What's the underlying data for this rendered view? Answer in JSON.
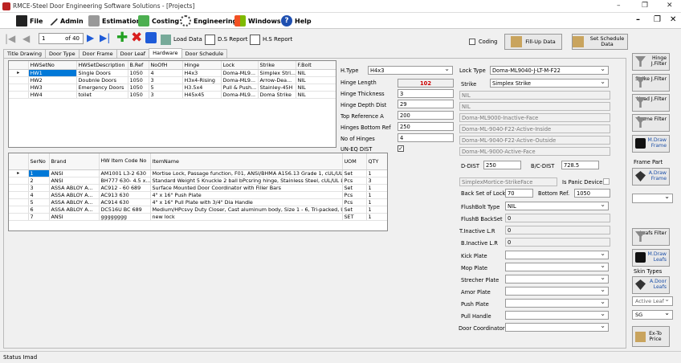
{
  "window": {
    "title": "RMCE-Steel Door Engineering Software Solutions - [Projects]"
  },
  "menu": [
    "File",
    "Admin",
    "Estimation",
    "Costing",
    "Engineering",
    "Windows",
    "Help"
  ],
  "toolbar": {
    "record": "1",
    "of": "of 40",
    "load_data": "Load Data",
    "ds_report": "D.S Report",
    "hs_report": "H.S Report",
    "coding": "Coding",
    "fill_up": "Fill-Up Data",
    "set_schedule": "Set Schedule Data"
  },
  "tabs": [
    "Title Drawing",
    "Door Type",
    "Door Frame",
    "Door Leaf",
    "Hardware",
    "Door Schedule"
  ],
  "hw_grid": {
    "headers": [
      "HWSetNo",
      "HWSetDescription",
      "B.Ref",
      "NoOfH",
      "Hinge",
      "Lock",
      "Strike",
      "F.Bolt"
    ],
    "rows": [
      [
        "HW1",
        "Single Doors",
        "1050",
        "4",
        "H4x3",
        "Doma-ML9...",
        "Simplex Stri...",
        "NIL"
      ],
      [
        "HW2",
        "Doubnle Doors",
        "1050",
        "3",
        "H3x4-Rising",
        "Doma-ML9...",
        "Arrow-Dea...",
        "NIL"
      ],
      [
        "HW3",
        "Emergency Doors",
        "1050",
        "5",
        "H3.5x4",
        "Pull & Push...",
        "Stainley-45H",
        "NIL"
      ],
      [
        "HW4",
        "toilet",
        "1050",
        "3",
        "H45x45",
        "Doma-ML9...",
        "Doma Strike",
        "NIL"
      ]
    ]
  },
  "items_grid": {
    "headers": [
      "SerNo",
      "Brand",
      "HW Item Code No",
      "ItemName",
      "UOM",
      "QTY"
    ],
    "rows": [
      [
        "1",
        "ANSI",
        "AM1001 L3-2 630",
        "Mortise Lock, Passage function, F01, ANSI/BHMA A156.13 Grade 1, cUL/UL...",
        "Set",
        "1"
      ],
      [
        "2",
        "ANSI",
        "BH777 630- 4.5 x...",
        "Standard Weight 5 Knuckle 2 ball bPcsring hinge, Stainless Steel, cUL/UL Lis...",
        "Pcs",
        "3"
      ],
      [
        "3",
        "ASSA ABLOY A...",
        "AC912 - 60 689",
        "Surface Mounted Door Coordinator with Filler Bars",
        "Set",
        "1"
      ],
      [
        "4",
        "ASSA ABLOY A...",
        "AC913 630",
        "4\" x 16\" Push Plate",
        "Pcs",
        "1"
      ],
      [
        "5",
        "ASSA ABLOY A...",
        "AC914 630",
        "4\" x 16\" Pull Plate with 3/4\" Dia Handle",
        "Pcs",
        "1"
      ],
      [
        "6",
        "ASSA ABLOY A...",
        "DC516U BC 689",
        "Medium/HPcsvy Duty Closer, Cast aluminum body, Size 1 - 6, Tri-packed, UL/...",
        "Set",
        "1"
      ],
      [
        "7",
        "ANSI",
        "gggggggg",
        "new lock",
        "SET",
        "1"
      ]
    ]
  },
  "hinge": {
    "h_type_label": "H.Type",
    "h_type": "H4x3",
    "length_label": "Hinge Length",
    "length": "102",
    "thickness_label": "Hinge Thickness",
    "thickness": "3",
    "depth_label": "Hinge Depth Dist",
    "depth": "29",
    "top_ref_label": "Top Reference A",
    "top_ref": "200",
    "bottom_ref_label": "Hinges Bottom Ref",
    "bottom_ref": "250",
    "count_label": "No of Hinges",
    "count": "4",
    "uneq_label": "UN-EQ DIST"
  },
  "lock": {
    "lock_type_label": "Lock Type",
    "lock_type": "Doma-ML9040-J-LT-M-F22",
    "strike_label": "Strike",
    "strike": "Simplex Strike",
    "info": [
      "NIL",
      "NIL",
      "Doma-ML9000-Inactive-Face",
      "Doma-ML-9040-F22-Active-Inside",
      "Doma-ML-9040-F22-Active-Outside",
      "Doma-ML-9000-Active-Face"
    ],
    "d_dist_label": "D-DIST",
    "d_dist": "250",
    "bc_dist_label": "B/C-DIST",
    "bc_dist": "728.5",
    "mortise": "SimplexMortice-StrikeFace",
    "panic_label": "Is Panic Device:",
    "backset_label": "Back Set of Lock",
    "backset": "70",
    "bottom_ref_label": "Bottom Ref.",
    "bottom_ref": "1050",
    "flushbolt_label": "FlushBolt Type",
    "flushbolt": "NIL",
    "flushb_backset_label": "FlushB BackSet",
    "flushb_backset": "0",
    "t_inactive_label": "T.Inactive L.R",
    "t_inactive": "0",
    "b_inactive_label": "B.Inactive L.R",
    "b_inactive": "0",
    "kick_label": "Kick Plate",
    "mop_label": "Mop Plate",
    "strecher_label": "Strecher Plate",
    "armor_label": "Amor Plate",
    "push_label": "Push Plate",
    "pull_label": "Pull Handle",
    "coordinator_label": "Door Coordinator"
  },
  "side": {
    "hinge_filter": "Hinge J.Filter",
    "strike_filter": "Strike J.Filter",
    "head_filter": "Head J.Filter",
    "frame_filter": "Frame Filter",
    "m_draw_frame": "M.Draw Frame",
    "frame_part": "Frame Part",
    "a_draw_frame": "A.Draw Frame",
    "leafs_filter": "Leafs Filter",
    "m_draw_leafs": "M.Draw Leafs",
    "skin_types": "Skin Types",
    "a_door_leafs": "A.Door Leafs",
    "active_leaf": "Active Leaf",
    "sg": "SG",
    "ex_to_price": "Ex-To Price"
  },
  "status": "Status  Imad"
}
